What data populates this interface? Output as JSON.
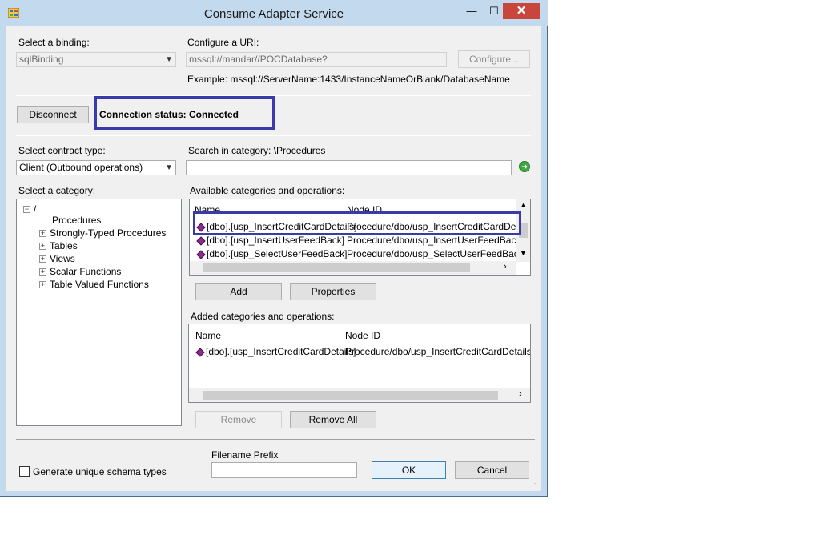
{
  "window": {
    "title": "Consume Adapter Service",
    "minimize": "—",
    "maximize": "☐",
    "close": "✕"
  },
  "binding": {
    "label": "Select a binding:",
    "value": "sqlBinding"
  },
  "uri": {
    "label": "Configure a URI:",
    "value": "mssql://mandar//POCDatabase?",
    "configure_button": "Configure...",
    "example": "Example: mssql://ServerName:1433/InstanceNameOrBlank/DatabaseName"
  },
  "connection": {
    "disconnect_button": "Disconnect",
    "status": "Connection status: Connected"
  },
  "contract": {
    "label": "Select contract type:",
    "value": "Client (Outbound operations)"
  },
  "search": {
    "label": "Search in category: \\Procedures",
    "value": ""
  },
  "category": {
    "label": "Select a category:",
    "root": "/",
    "items": [
      {
        "label": "Procedures",
        "expandable": false
      },
      {
        "label": "Strongly-Typed Procedures",
        "expandable": true
      },
      {
        "label": "Tables",
        "expandable": true
      },
      {
        "label": "Views",
        "expandable": true
      },
      {
        "label": "Scalar Functions",
        "expandable": true
      },
      {
        "label": "Table Valued Functions",
        "expandable": true
      }
    ]
  },
  "available": {
    "label": "Available categories and operations:",
    "col_name": "Name",
    "col_node": "Node ID",
    "rows": [
      {
        "name": "[dbo].[usp_InsertCreditCardDetails]",
        "node": "Procedure/dbo/usp_InsertCreditCardDetails"
      },
      {
        "name": "[dbo].[usp_InsertUserFeedBack]",
        "node": "Procedure/dbo/usp_InsertUserFeedBack"
      },
      {
        "name": "[dbo].[usp_SelectUserFeedBack]",
        "node": "Procedure/dbo/usp_SelectUserFeedBack"
      }
    ],
    "add_button": "Add",
    "properties_button": "Properties"
  },
  "added": {
    "label": "Added categories and operations:",
    "col_name": "Name",
    "col_node": "Node ID",
    "rows": [
      {
        "name": "[dbo].[usp_InsertCreditCardDetails]",
        "node": "Procedure/dbo/usp_InsertCreditCardDetails"
      }
    ],
    "remove_button": "Remove",
    "remove_all_button": "Remove All"
  },
  "footer": {
    "generate_unique": "Generate unique schema types",
    "filename_prefix_label": "Filename Prefix",
    "filename_prefix_value": "",
    "ok_button": "OK",
    "cancel_button": "Cancel"
  },
  "colors": {
    "frame": "#c3d9ee",
    "highlight": "#3a3aa8",
    "close": "#c9463d"
  }
}
